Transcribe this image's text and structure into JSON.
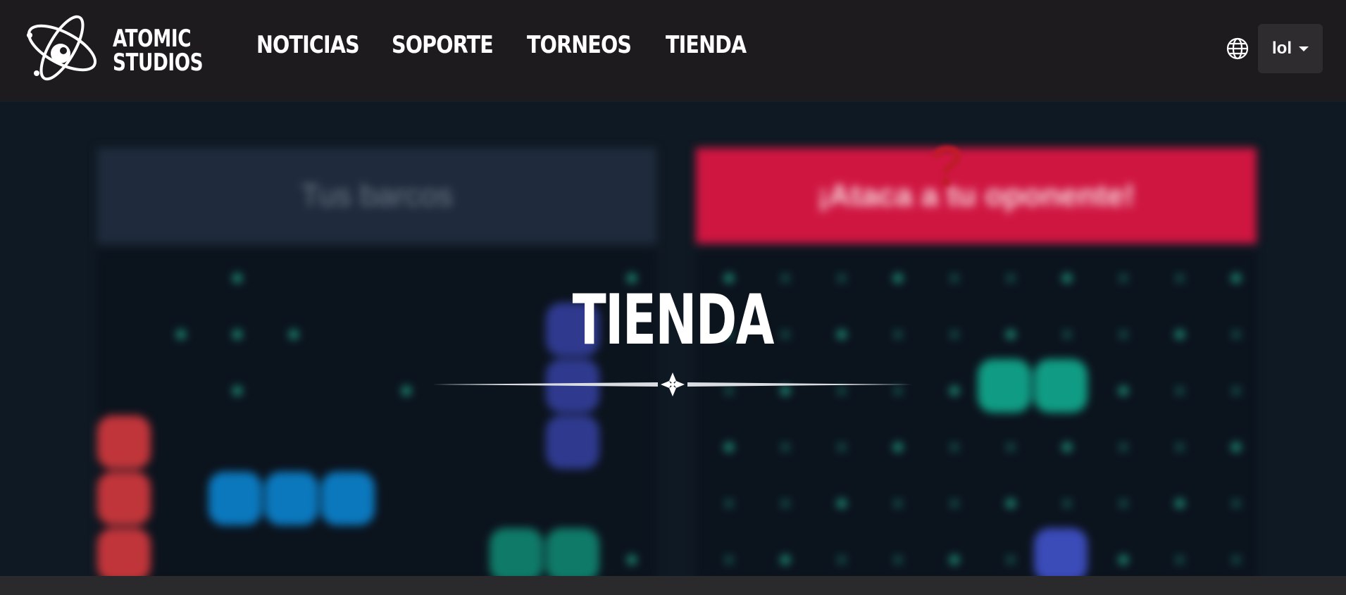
{
  "brand": {
    "line1": "ATOMIC",
    "line2": "STUDIOS"
  },
  "nav": [
    {
      "label": "NOTICIAS"
    },
    {
      "label": "SOPORTE"
    },
    {
      "label": "TORNEOS"
    },
    {
      "label": "TIENDA"
    }
  ],
  "language": {
    "icon": "globe-icon",
    "current": "lol"
  },
  "page": {
    "title": "TIENDA"
  },
  "game": {
    "left_heading": "Tus barcos",
    "right_heading": "¡Ataca a tu oponente!",
    "marker": "?"
  },
  "colors": {
    "header_bg": "#1d1b1e",
    "page_bg": "#0f1923",
    "attack_red": "#cf1641",
    "ship_red": "#c0353a",
    "ship_blue": "#0b78bd",
    "ship_indigo": "#2f3a8f",
    "ship_teal": "#0f7a68",
    "ship_mint": "#109c84",
    "dot_teal": "#1d8b78"
  }
}
